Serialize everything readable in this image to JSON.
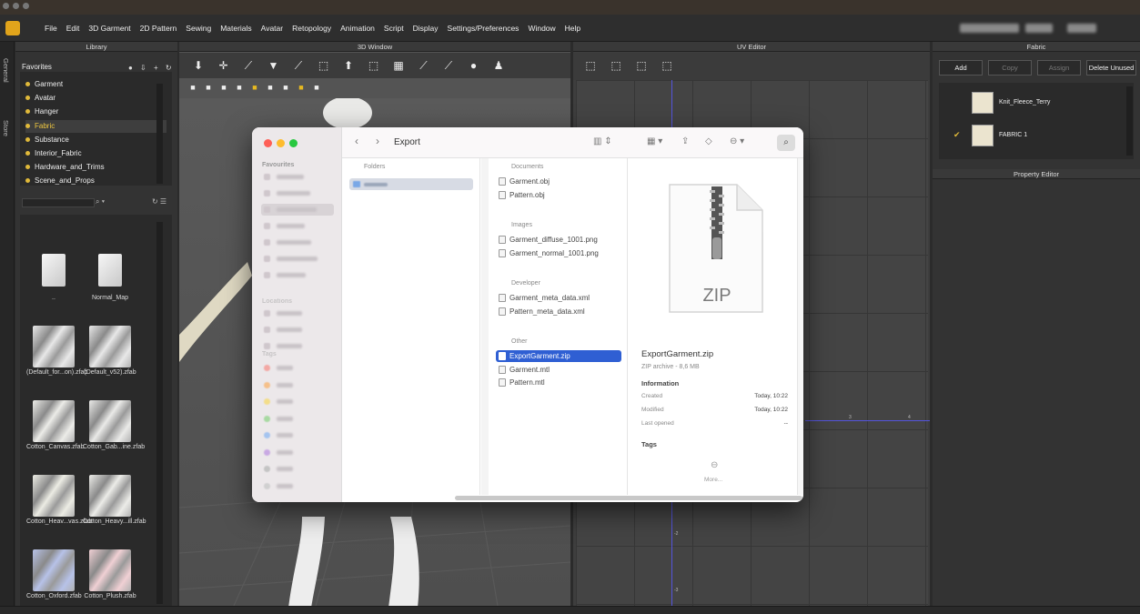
{
  "menu": [
    "File",
    "Edit",
    "3D Garment",
    "2D Pattern",
    "Sewing",
    "Materials",
    "Avatar",
    "Retopology",
    "Animation",
    "Script",
    "Display",
    "Settings/Preferences",
    "Window",
    "Help"
  ],
  "side_tabs": [
    "General",
    "Store"
  ],
  "library": {
    "title": "Library",
    "favorites_label": "Favorites",
    "tree": [
      "Garment",
      "Avatar",
      "Hanger",
      "Fabric",
      "Substance",
      "Interior_Fabric",
      "Hardware_and_Trims",
      "Scene_and_Props"
    ],
    "selected_index": 3,
    "items": [
      {
        "label": "..",
        "kind": "folder"
      },
      {
        "label": "Normal_Map",
        "kind": "folder"
      },
      {
        "label": "(Default_for...on).zfab",
        "kind": "fabric",
        "color": "#e8e8e8"
      },
      {
        "label": "(Default_v52).zfab",
        "kind": "fabric",
        "color": "#e8e8e8"
      },
      {
        "label": "Cotton_Canvas.zfab",
        "kind": "fabric",
        "color": "#ecece8"
      },
      {
        "label": "Cotton_Gab...ine.zfab",
        "kind": "fabric",
        "color": "#eaeae8"
      },
      {
        "label": "Cotton_Heav...vas.zfab",
        "kind": "fabric",
        "color": "#ecece4"
      },
      {
        "label": "Cotton_Heavy...ill.zfab",
        "kind": "fabric",
        "color": "#ecece8"
      },
      {
        "label": "Cotton_Oxford.zfab",
        "kind": "fabric",
        "color": "#b7c2e8"
      },
      {
        "label": "Cotton_Plush.zfab",
        "kind": "fabric",
        "color": "#f0d0d4"
      }
    ]
  },
  "window3d": {
    "title": "3D Window"
  },
  "uv": {
    "title": "UV Editor",
    "tick_labels": [
      "3",
      "4",
      "-2",
      "-3"
    ]
  },
  "fabric": {
    "title": "Fabric",
    "buttons": {
      "add": "Add",
      "copy": "Copy",
      "assign": "Assign",
      "delete_unused": "Delete Unused"
    },
    "list": [
      {
        "name": "Knit_Fleece_Terry",
        "checked": false
      },
      {
        "name": "FABRIC 1",
        "checked": true
      }
    ]
  },
  "property": {
    "title": "Property Editor"
  },
  "finder": {
    "title": "Export",
    "sidebar_heads": {
      "favourites": "Favourites",
      "locations": "Locations",
      "tags": "Tags"
    },
    "col1_head": "Folders",
    "col2_head": "Documents",
    "groups": [
      {
        "head": "Documents",
        "files": [
          "Garment.obj",
          "Pattern.obj"
        ]
      },
      {
        "head": "Images",
        "files": [
          "Garment_diffuse_1001.png",
          "Garment_normal_1001.png"
        ]
      },
      {
        "head": "Developer",
        "files": [
          "Garment_meta_data.xml",
          "Pattern_meta_data.xml"
        ]
      },
      {
        "head": "Other",
        "files": [
          "ExportGarment.zip",
          "Garment.mtl",
          "Pattern.mtl"
        ]
      }
    ],
    "selected_file": "ExportGarment.zip",
    "preview": {
      "badge": "ZIP",
      "name": "ExportGarment.zip",
      "meta": "ZIP archive - 8,6 MB",
      "information_label": "Information",
      "created_label": "Created",
      "created": "Today, 10:22",
      "modified_label": "Modified",
      "modified": "Today, 10:22",
      "last_opened_label": "Last opened",
      "last_opened": "--",
      "tags_label": "Tags",
      "more_label": "More..."
    }
  }
}
